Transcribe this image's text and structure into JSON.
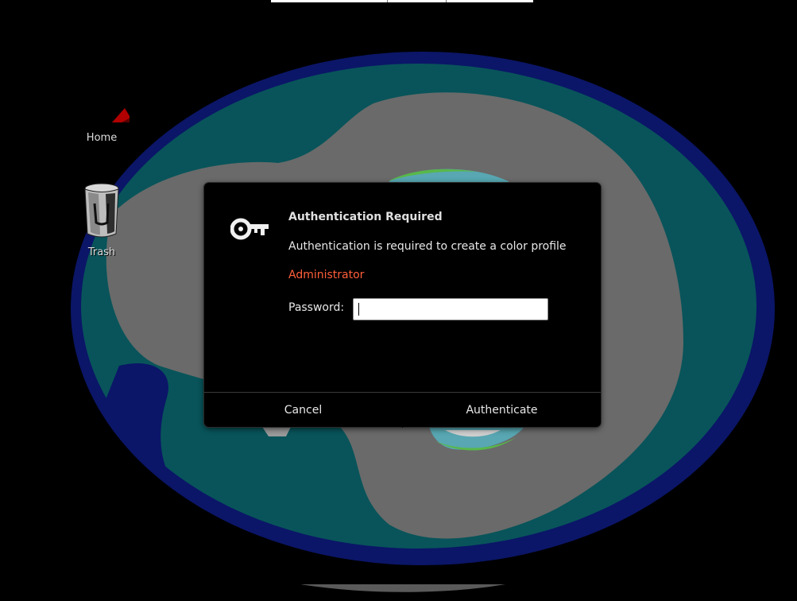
{
  "desktop": {
    "icons": [
      {
        "label": "Home"
      },
      {
        "label": "Trash"
      }
    ]
  },
  "dialog": {
    "title": "Authentication Required",
    "message": "Authentication is required to create a color profile",
    "user": "Administrator",
    "password_label": "Password:",
    "password_value": "",
    "cancel_label": "Cancel",
    "authenticate_label": "Authenticate",
    "icon": "key-icon",
    "colors": {
      "user_accent": "#ff5e3a",
      "dialog_bg": "#000000"
    }
  }
}
